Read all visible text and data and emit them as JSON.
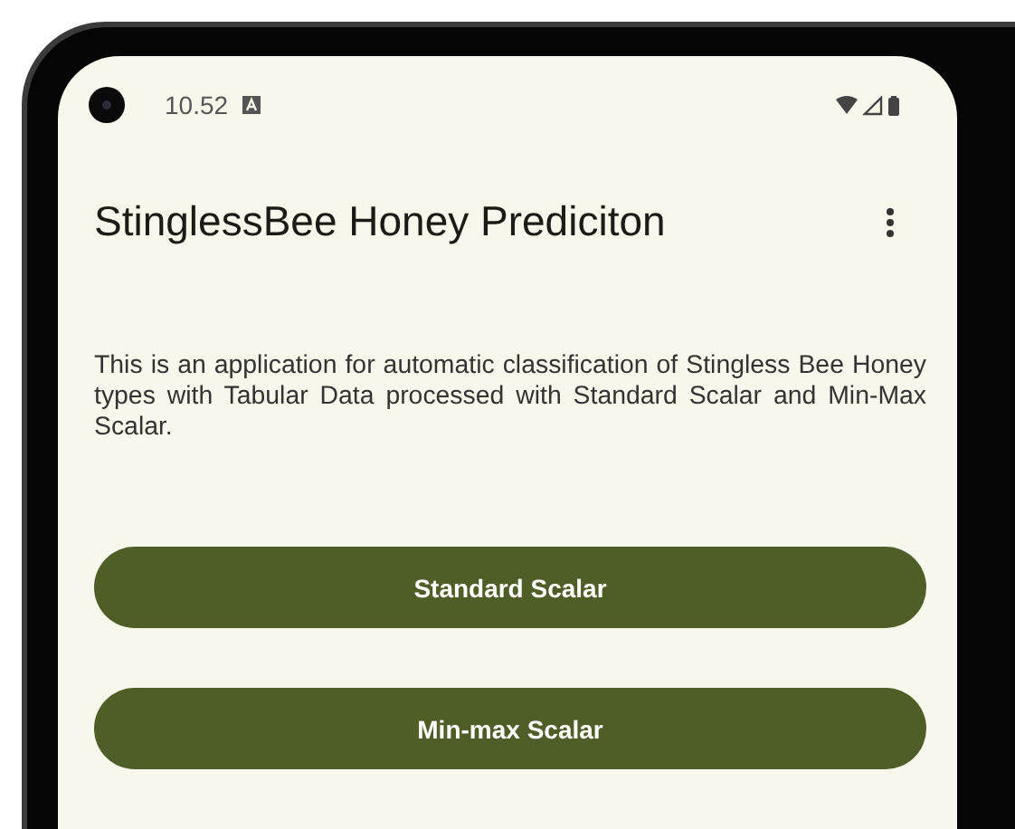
{
  "status_bar": {
    "time": "10.52"
  },
  "app_bar": {
    "title": "StinglessBee Honey Prediciton"
  },
  "description": "This is an application for automatic classification of Stingless Bee Honey types with Tabular Data processed with Standard Scalar and Min-Max Scalar.",
  "buttons": [
    {
      "label": "Standard Scalar"
    },
    {
      "label": "Min-max Scalar"
    }
  ]
}
